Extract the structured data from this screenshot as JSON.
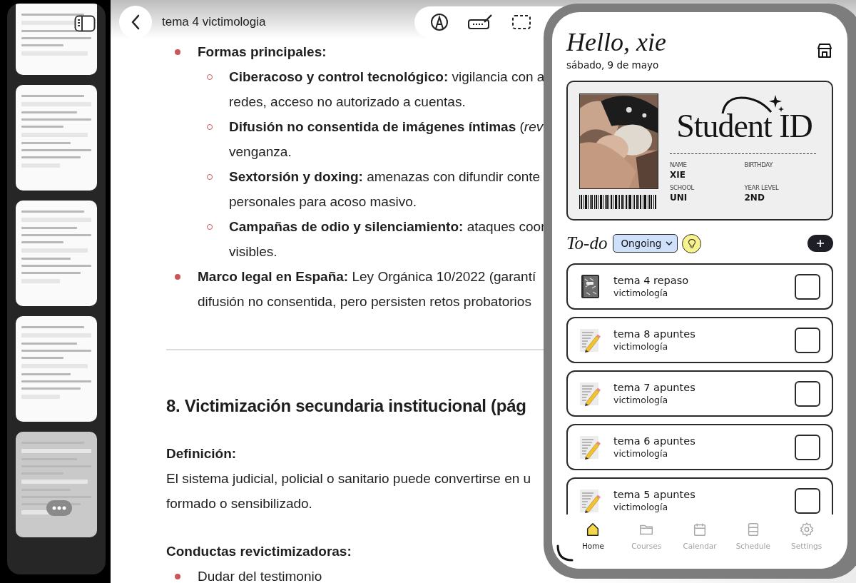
{
  "sidebar": {
    "pages": [
      {
        "selected": false
      },
      {
        "selected": false
      },
      {
        "selected": false
      },
      {
        "selected": false
      },
      {
        "selected": true
      }
    ]
  },
  "document": {
    "title": "tema 4 victimologia",
    "blocks": [
      {
        "kind": "bullet",
        "lines": [
          "**Formas principales:**"
        ]
      },
      {
        "kind": "subbullet",
        "lines": [
          "**Ciberacoso y control tecnológico:** vigilancia con a",
          "redes, acceso no autorizado a cuentas."
        ]
      },
      {
        "kind": "subbullet",
        "lines": [
          "**Difusión no consentida de imágenes íntimas** (*rev*",
          "venganza."
        ]
      },
      {
        "kind": "subbullet",
        "lines": [
          "**Sextorsión y doxing:** amenazas con difundir conte",
          "personales para acoso masivo."
        ]
      },
      {
        "kind": "subbullet",
        "lines": [
          "**Campañas de odio y silenciamiento:** ataques coor",
          "visibles."
        ]
      },
      {
        "kind": "bullet",
        "lines": [
          "**Marco legal en España:** Ley Orgánica 10/2022 (garantí",
          "difusión no consentida, pero persisten retos probatorios"
        ]
      },
      {
        "kind": "rule"
      },
      {
        "kind": "heading",
        "lines": [
          "8. Victimización secundaria institucional (pág"
        ]
      },
      {
        "kind": "label",
        "lines": [
          "Definición:"
        ]
      },
      {
        "kind": "paragraph",
        "lines": [
          "El sistema judicial, policial o sanitario puede convertirse en u",
          "formado o sensibilizado."
        ]
      },
      {
        "kind": "label",
        "lines": [
          "Conductas revictimizadoras:"
        ]
      },
      {
        "kind": "bullet",
        "lines": [
          "Dudar del testimonio"
        ]
      }
    ]
  },
  "app": {
    "greeting": "Hello, xie",
    "date": "sábado, 9 de mayo",
    "card": {
      "title": "Student ID",
      "fields": [
        {
          "label": "NAME",
          "value": "XIE"
        },
        {
          "label": "BIRTHDAY"
        },
        {
          "label": "SCHOOL",
          "value": "UNI"
        },
        {
          "label": "YEAR LEVEL",
          "value": "2ND"
        }
      ]
    },
    "todo": {
      "title": "To-do",
      "filter": "Ongoing",
      "tasks": [
        {
          "kind": "notebook",
          "title": "tema 4 repaso",
          "subject": "victimología",
          "checked": false
        },
        {
          "kind": "notes",
          "title": "tema 8 apuntes",
          "subject": "victimología",
          "checked": false
        },
        {
          "kind": "notes",
          "title": "tema 7 apuntes",
          "subject": "victimología",
          "checked": false
        },
        {
          "kind": "notes",
          "title": "tema 6 apuntes",
          "subject": "victimología",
          "checked": false
        },
        {
          "kind": "notes",
          "title": "tema 5 apuntes",
          "subject": "victimología",
          "checked": false
        }
      ]
    },
    "nav": [
      {
        "kind": "home",
        "label": "Home",
        "selected": true
      },
      {
        "kind": "courses",
        "label": "Courses",
        "selected": false
      },
      {
        "kind": "calendar",
        "label": "Calendar",
        "selected": false
      },
      {
        "kind": "schedule",
        "label": "Schedule",
        "selected": false
      },
      {
        "kind": "settings",
        "label": "Settings",
        "selected": false
      }
    ]
  }
}
